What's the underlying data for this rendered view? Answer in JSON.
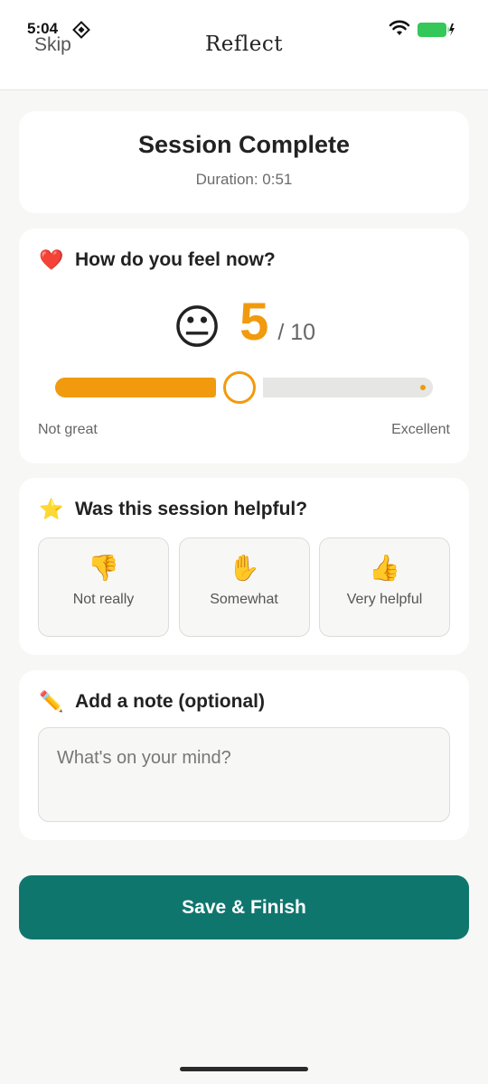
{
  "status_bar": {
    "time": "5:04"
  },
  "header": {
    "skip_label": "Skip",
    "title": "Reflect"
  },
  "summary": {
    "title": "Session Complete",
    "duration_label": "Duration: ",
    "duration_value": "0:51"
  },
  "mood": {
    "heading_icon": "❤️",
    "heading": "How do you feel now?",
    "face": "😐",
    "value": "5",
    "max_label": "/ 10",
    "min_label": "Not great",
    "max_scale_label": "Excellent",
    "slider_fraction": 0.444
  },
  "helpful": {
    "heading_icon": "⭐",
    "heading": "Was this session helpful?",
    "options": [
      {
        "icon": "👎",
        "label": "Not really"
      },
      {
        "icon": "✋",
        "label": "Somewhat"
      },
      {
        "icon": "👍",
        "label": "Very helpful"
      }
    ]
  },
  "note": {
    "heading_icon": "✏️",
    "heading": "Add a note (optional)",
    "placeholder": "What's on your mind?",
    "value": ""
  },
  "actions": {
    "save_label": "Save & Finish"
  },
  "colors": {
    "accent": "#f19a0e",
    "primary": "#0f766e",
    "background": "#f7f7f5"
  }
}
